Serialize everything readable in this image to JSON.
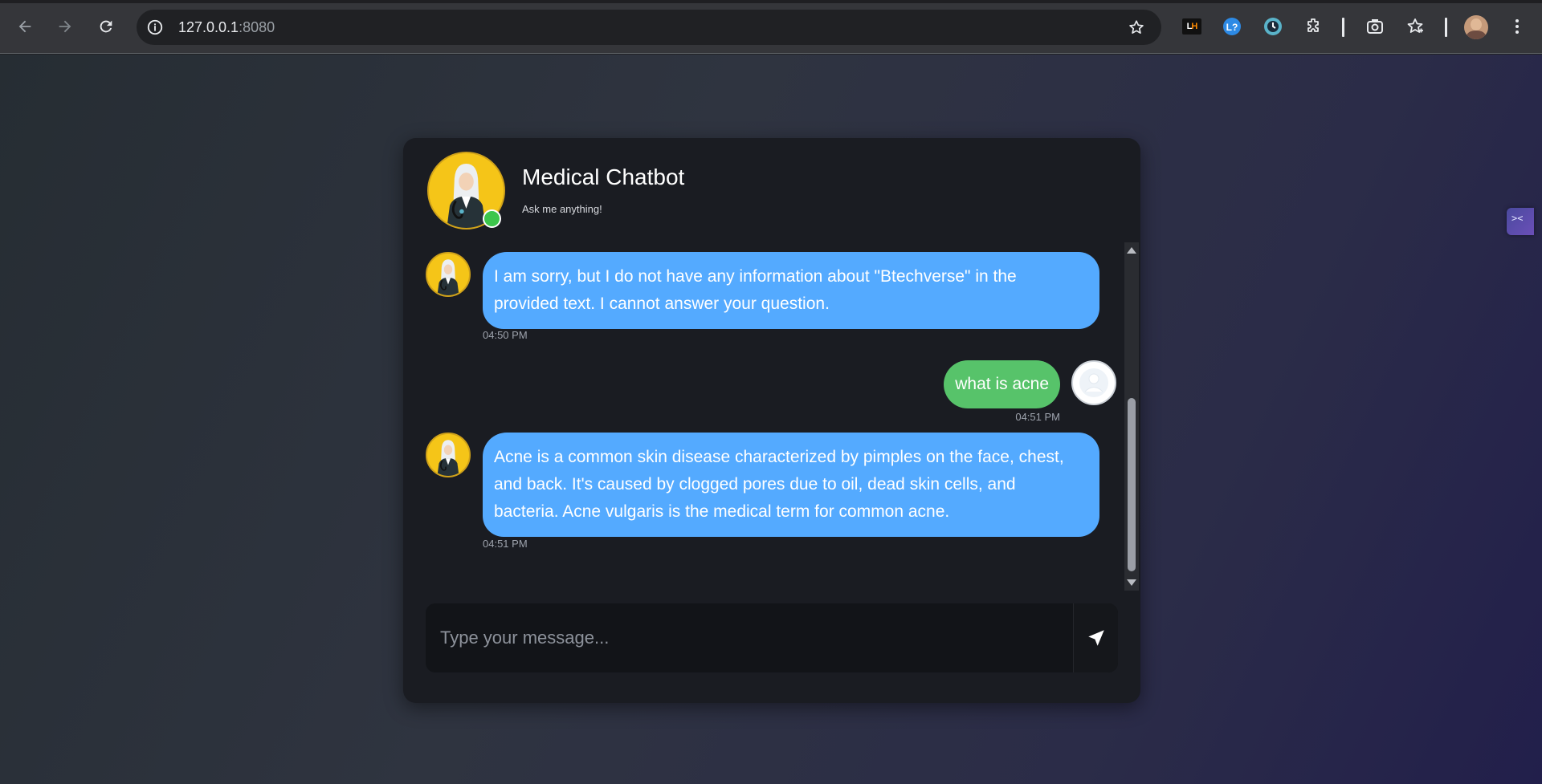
{
  "browser": {
    "url_host": "127.0.0.1",
    "url_port": ":8080",
    "extensions": [
      {
        "name": "lighthouse",
        "label_l": "L",
        "label_h": "H"
      },
      {
        "name": "lastpass"
      },
      {
        "name": "clockify"
      },
      {
        "name": "extensions-puzzle"
      }
    ]
  },
  "chat": {
    "title": "Medical Chatbot",
    "subtitle": "Ask me anything!",
    "status_color": "#3cc64b",
    "messages": [
      {
        "role": "bot",
        "text": "I am sorry, but I do not have any information about \"Btechverse\" in the provided text. I cannot answer your question.",
        "time": "04:50 PM"
      },
      {
        "role": "user",
        "text": "what is acne",
        "time": "04:51 PM"
      },
      {
        "role": "bot",
        "text": "Acne is a common skin disease characterized by pimples on the face, chest, and back. It's caused by clogged pores due to oil, dead skin cells, and bacteria. Acne vulgaris is the medical term for common acne.",
        "time": "04:51 PM"
      }
    ],
    "input": {
      "placeholder": "Type your message...",
      "value": ""
    },
    "colors": {
      "bot_bubble": "#54aaff",
      "user_bubble": "#57c36a",
      "card_bg": "#1a1c22"
    }
  },
  "side_tab": {
    "glyph": "><"
  }
}
